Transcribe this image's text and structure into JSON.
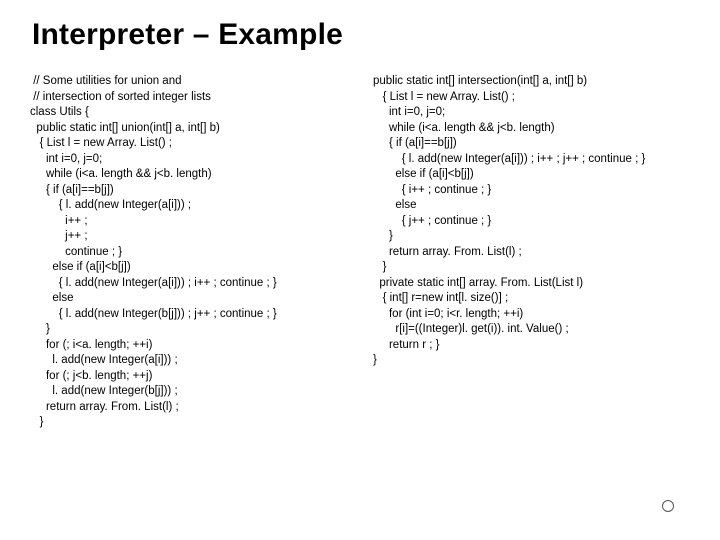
{
  "title": "Interpreter – Example",
  "code_left": " // Some utilities for union and\n // intersection of sorted integer lists\nclass Utils {\n  public static int[] union(int[] a, int[] b)\n   { List l = new Array. List() ;\n     int i=0, j=0;\n     while (i<a. length && j<b. length)\n     { if (a[i]==b[j])\n         { l. add(new Integer(a[i])) ;\n           i++ ;\n           j++ ;\n           continue ; }\n       else if (a[i]<b[j])\n         { l. add(new Integer(a[i])) ; i++ ; continue ; }\n       else\n         { l. add(new Integer(b[j])) ; j++ ; continue ; }\n     }\n     for (; i<a. length; ++i)\n       l. add(new Integer(a[i])) ;\n     for (; j<b. length; ++j)\n       l. add(new Integer(b[j])) ;\n     return array. From. List(l) ;\n   }",
  "code_right": "public static int[] intersection(int[] a, int[] b)\n   { List l = new Array. List() ;\n     int i=0, j=0;\n     while (i<a. length && j<b. length)\n     { if (a[i]==b[j])\n         { l. add(new Integer(a[i])) ; i++ ; j++ ; continue ; }\n       else if (a[i]<b[j])\n         { i++ ; continue ; }\n       else\n         { j++ ; continue ; }\n     }\n     return array. From. List(l) ;\n   }\n  private static int[] array. From. List(List l)\n   { int[] r=new int[l. size()] ;\n     for (int i=0; i<r. length; ++i)\n       r[i]=((Integer)l. get(i)). int. Value() ;\n     return r ; }\n}"
}
